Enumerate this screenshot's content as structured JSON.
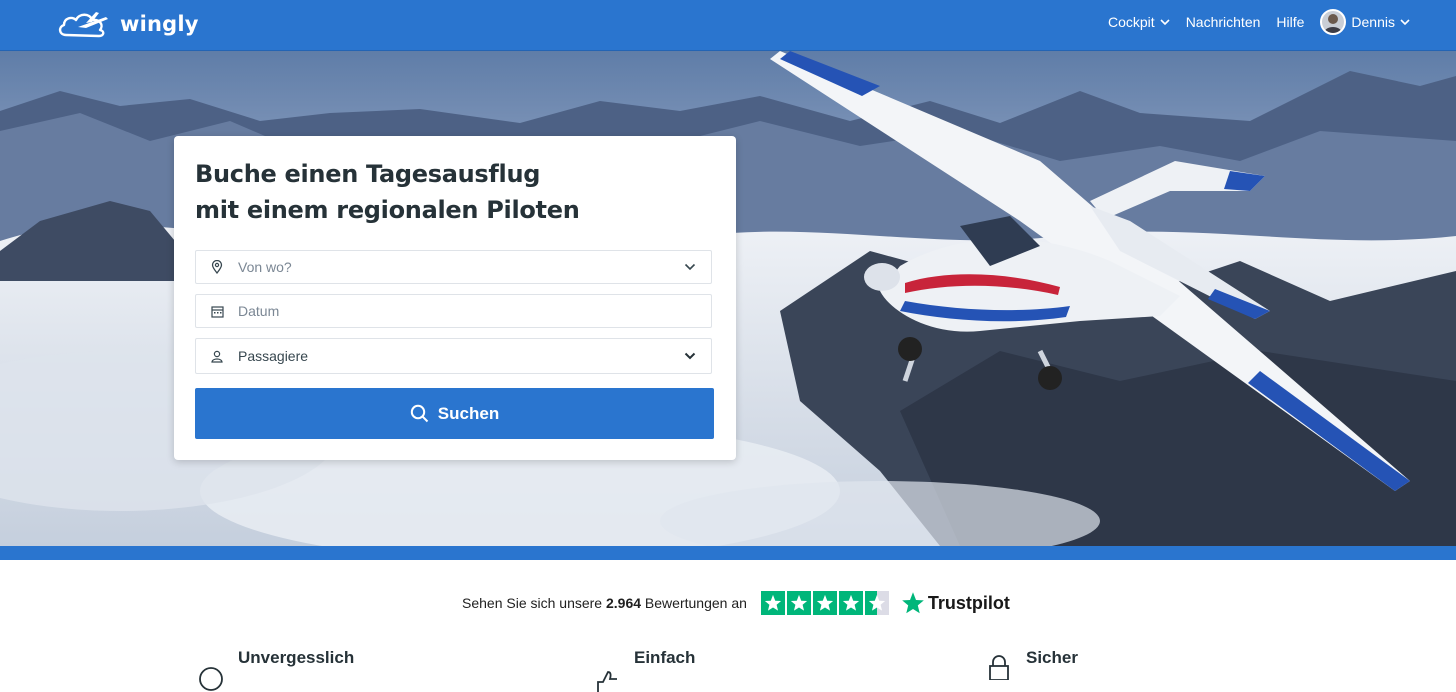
{
  "nav": {
    "logo_text": "wingly",
    "cockpit_label": "Cockpit",
    "messages_label": "Nachrichten",
    "help_label": "Hilfe",
    "user_name": "Dennis"
  },
  "search": {
    "title_line1": "Buche einen Tagesausflug",
    "title_line2": "mit einem regionalen Piloten",
    "from_placeholder": "Von wo?",
    "date_placeholder": "Datum",
    "passengers_label": "Passagiere",
    "button_label": "Suchen"
  },
  "trustpilot": {
    "prefix": "Sehen Sie sich unsere",
    "count": "2.964",
    "suffix": "Bewertungen an",
    "brand": "Trustpilot",
    "stars": 4.5
  },
  "features": [
    {
      "title": "Unvergesslich",
      "icon": "smiley-icon"
    },
    {
      "title": "Einfach",
      "icon": "thumbs-up-icon"
    },
    {
      "title": "Sicher",
      "icon": "lock-icon"
    }
  ],
  "colors": {
    "brand_blue": "#2a75cf",
    "trustpilot_green": "#00b67a"
  }
}
